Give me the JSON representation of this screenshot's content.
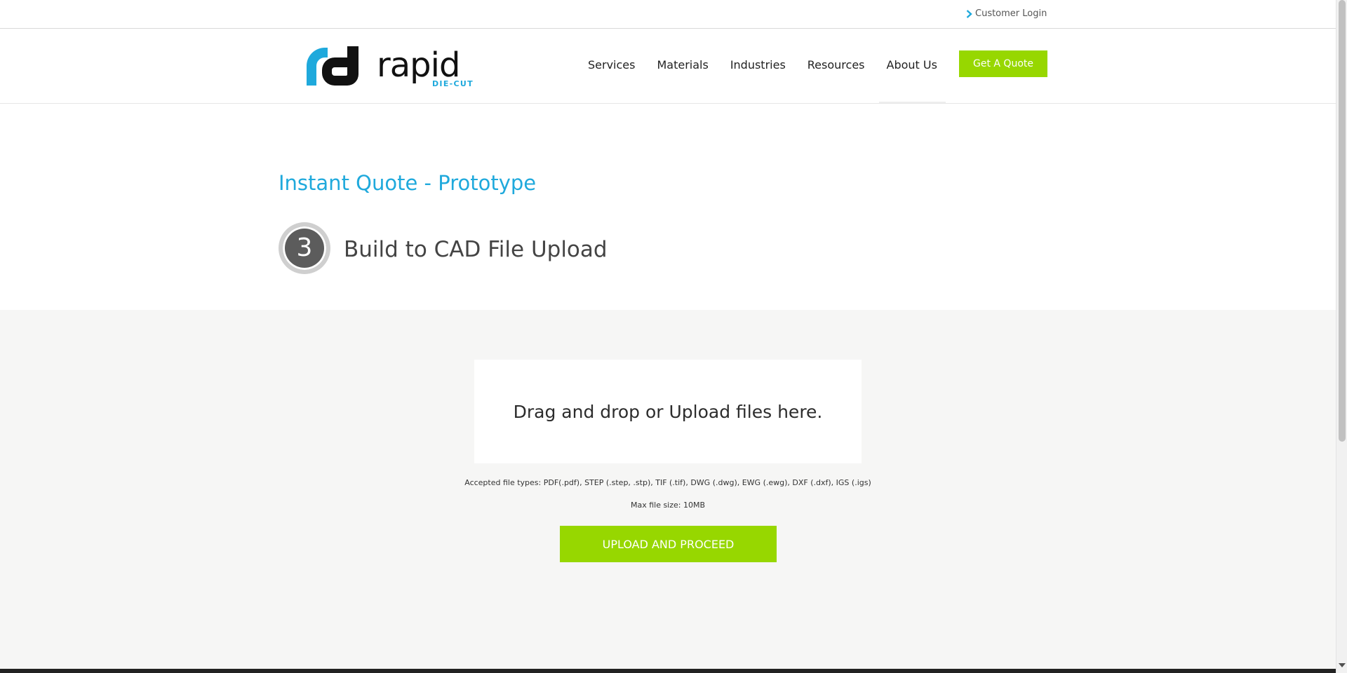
{
  "topbar": {
    "login_label": "Customer Login"
  },
  "header": {
    "logo": {
      "word": "rapid",
      "tagline": "DIE-CUT"
    },
    "nav": [
      "Services",
      "Materials",
      "Industries",
      "Resources",
      "About Us"
    ],
    "quote_button": "Get A Quote"
  },
  "hero": {
    "title": "Instant Quote - Prototype",
    "step_number": "3",
    "step_title": "Build to CAD File Upload"
  },
  "upload": {
    "dropzone_text": "Drag and drop or Upload files here.",
    "accepted_types": "Accepted file types: PDF(.pdf), STEP (.step, .stp), TIF (.tif), DWG (.dwg), EWG (.ewg), DXF (.dxf), IGS (.igs)",
    "max_size": "Max file size: 10MB",
    "button_label": "UPLOAD AND PROCEED"
  },
  "colors": {
    "brand_blue": "#1fa9dc",
    "accent_green": "#97d700",
    "content_gray": "#f6f6f5"
  },
  "icons": {
    "login": "chevron-right-icon",
    "logo": "rapid-die-cut-logo-mark"
  }
}
